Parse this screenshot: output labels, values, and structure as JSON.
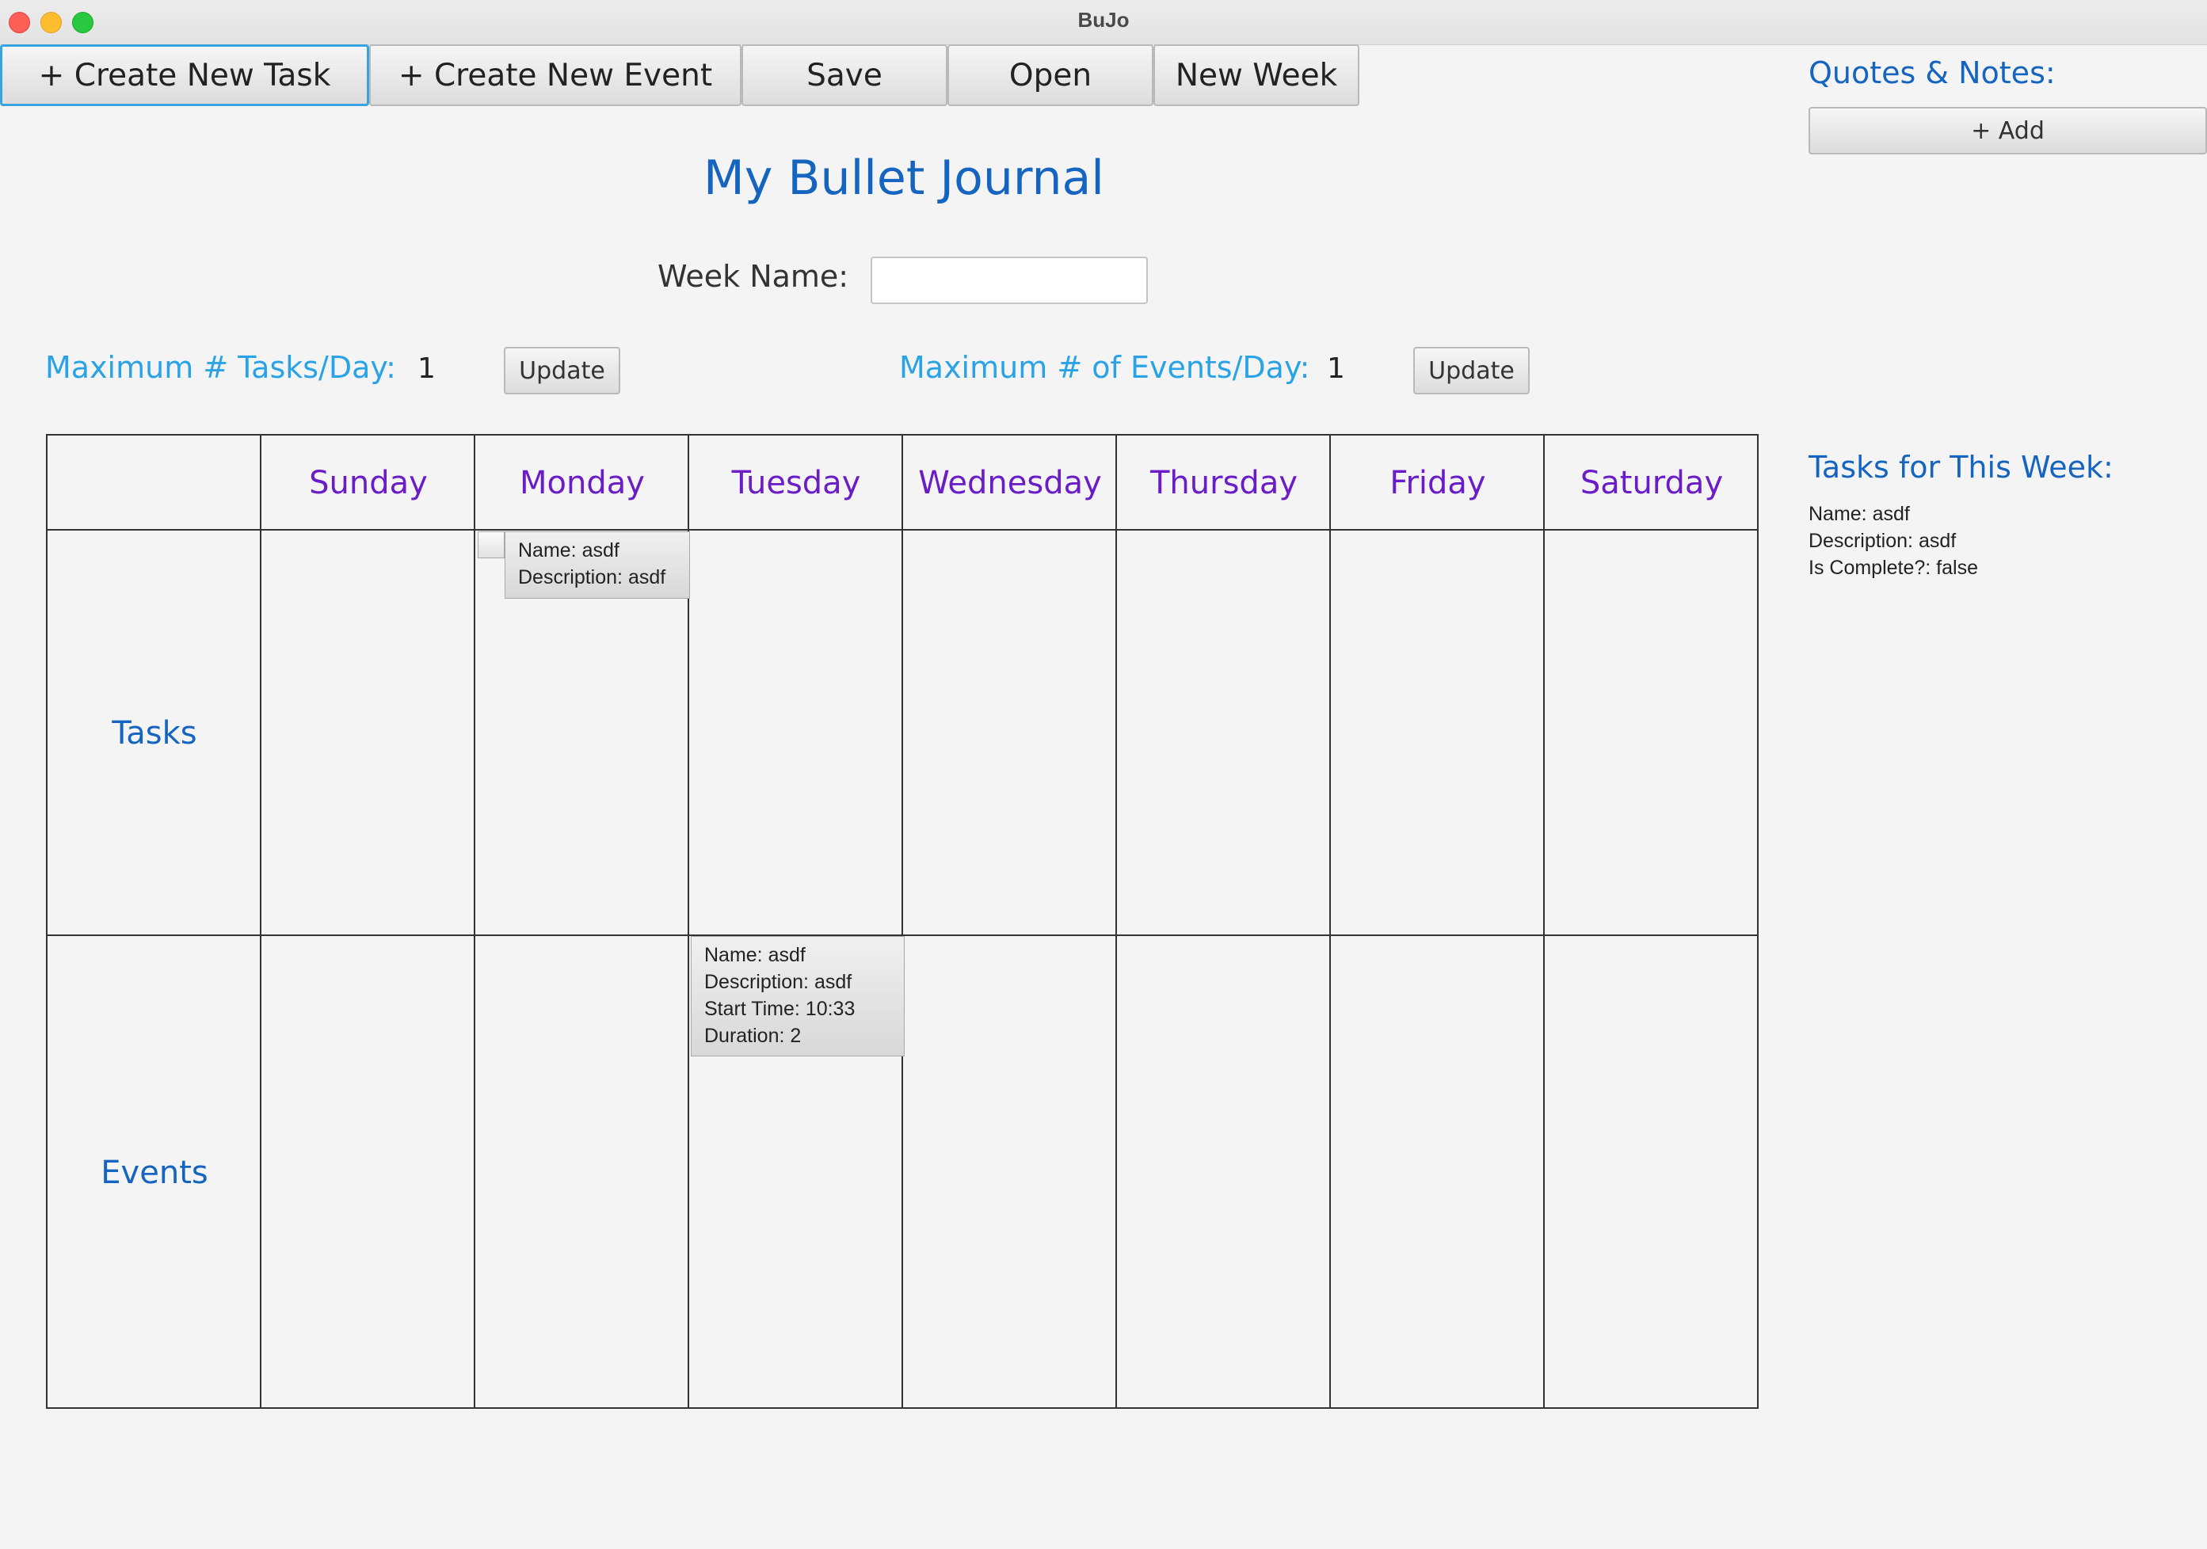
{
  "window": {
    "title": "BuJo"
  },
  "toolbar": {
    "create_task": "+ Create New Task",
    "create_event": "+ Create New Event",
    "save": "Save",
    "open": "Open",
    "new_week": "New Week"
  },
  "header": {
    "title": "My Bullet Journal",
    "week_name_label": "Week Name:",
    "week_name_value": ""
  },
  "limits": {
    "tasks_label": "Maximum # Tasks/Day:",
    "tasks_value": "1",
    "events_label": "Maximum # of Events/Day:",
    "events_value": "1",
    "update_label": "Update"
  },
  "grid": {
    "days": [
      "Sunday",
      "Monday",
      "Tuesday",
      "Wednesday",
      "Thursday",
      "Friday",
      "Saturday"
    ],
    "rows": [
      "Tasks",
      "Events"
    ],
    "monday_task": {
      "name": "Name: asdf",
      "description": "Description: asdf"
    },
    "tuesday_event": {
      "name": "Name: asdf",
      "description": "Description: asdf",
      "start_time": "Start Time: 10:33",
      "duration": "Duration: 2"
    }
  },
  "sidebar": {
    "quotes_heading": "Quotes & Notes:",
    "add_label": "+ Add",
    "tasks_heading": "Tasks for This Week:",
    "tasks": [
      {
        "name": "Name: asdf",
        "description": "Description: asdf",
        "complete": "Is Complete?: false"
      }
    ]
  },
  "colors": {
    "accent_blue": "#1565c0",
    "light_blue": "#29a3e6",
    "day_purple": "#6a1cc9",
    "focus_border": "#39a3e0"
  }
}
